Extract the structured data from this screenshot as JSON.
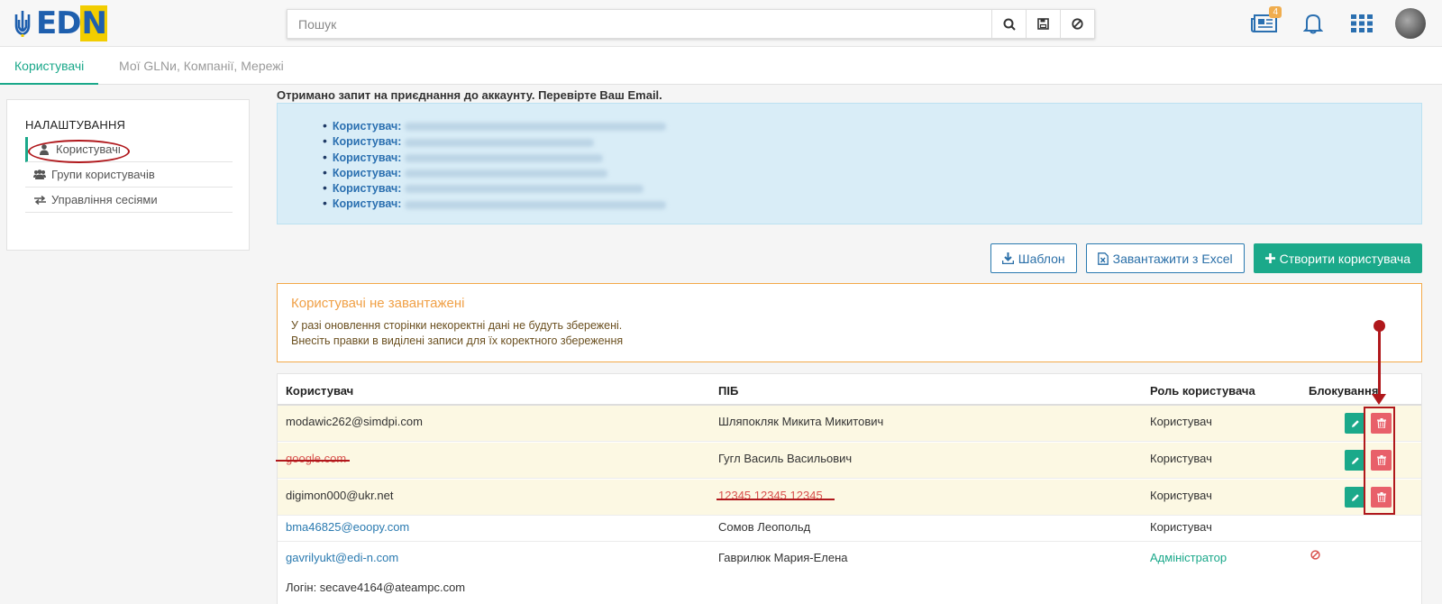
{
  "header": {
    "brand": "EDN",
    "search_placeholder": "Пошук",
    "news_badge": "4"
  },
  "tabs": [
    {
      "label": "Користувачі"
    },
    {
      "label": "Мої GLNи, Компанії, Мережі"
    }
  ],
  "sidebar": {
    "title": "НАЛАШТУВАННЯ",
    "items": [
      {
        "label": "Користувачі"
      },
      {
        "label": "Групи користувачів"
      },
      {
        "label": "Управління сесіями"
      }
    ]
  },
  "notice": {
    "title": "Отримано запит на приєднання до аккаунту. Перевірте Ваш Email.",
    "user_label": "Користувач:",
    "entries_count_label": ""
  },
  "actions": {
    "template": "Шаблон",
    "upload": "Завантажити з Excel",
    "create": "Створити користувача"
  },
  "warning": {
    "title": "Користувачі не завантажені",
    "line1": "У разі оновлення сторінки некоректні дані не будуть збережені.",
    "line2": "Внесіть правки в виділені записи для їх коректного збереження"
  },
  "table": {
    "columns": [
      "Користувач",
      "ПІБ",
      "Роль користувача",
      "Блокування"
    ],
    "rows": [
      {
        "user": "modawic262@simdpi.com",
        "name": "Шляпокляк Микита Микитович",
        "role": "Користувач"
      },
      {
        "user": "google.com",
        "name": "Гугл Василь Васильович",
        "role": "Користувач"
      },
      {
        "user": "digimon000@ukr.net",
        "name": "12345 12345 12345",
        "role": "Користувач"
      },
      {
        "user": "bma46825@eoopy.com",
        "name": "Сомов Леопольд",
        "role": "Користувач"
      },
      {
        "user": "gavrilyukt@edi-n.com",
        "name": "Гаврилюк Мария-Елена",
        "role": "Адміністратор",
        "login": "Логін: secave4164@ateampc.com"
      }
    ]
  },
  "colors": {
    "accent": "#1aa88a",
    "link": "#2a7ab0",
    "warning": "#f0a046",
    "error": "#d9534f",
    "annotation": "#b0181c"
  }
}
